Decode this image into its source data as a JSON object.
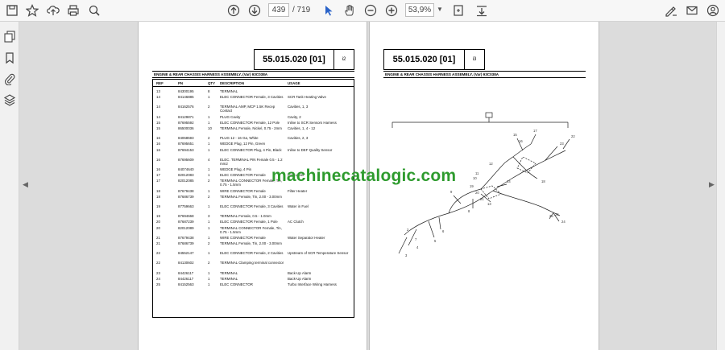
{
  "toolbar": {
    "current_page": "439",
    "page_total": "/ 719",
    "zoom_value": "53,9%",
    "icons": [
      "save-icon",
      "bookmark-star-icon",
      "upload-icon",
      "print-icon",
      "zoom-search-icon",
      "page-up-icon",
      "page-down-icon",
      "select-cursor-icon",
      "hand-tool-icon",
      "zoom-out-icon",
      "zoom-in-icon",
      "fit-page-icon",
      "scroll-mode-icon",
      "sign-icon",
      "email-icon",
      "account-icon"
    ]
  },
  "left_page": {
    "ref_number": "55.015.020 [01]",
    "ref_mark": "i2",
    "assembly_title": "ENGINE & REAR CHASSIS HARNESS ASSEMBLY, (Var) 93C038A",
    "headers": {
      "ref": "REF",
      "pn": "PN",
      "qty": "QTY",
      "desc": "DESCRIPTION",
      "usage": "USAGE"
    },
    "rows": [
      {
        "ref": "13",
        "pn": "84300195",
        "qty": "8",
        "desc": "TERMINAL",
        "usage": ""
      },
      {
        "ref": "14",
        "pn": "84146885",
        "qty": "1",
        "desc": "ELEC CONNECTOR Female, 3 Cavities",
        "usage": "SCR Tank Heating Valve"
      },
      {
        "ref": "14",
        "pn": "84162576",
        "qty": "2",
        "desc": "TERMINAL AMP, MCP 1.5K Recep Contact",
        "usage": "Cavities, 1, 3"
      },
      {
        "ref": "14",
        "pn": "84129871",
        "qty": "1",
        "desc": "PLUG Cavity",
        "usage": "Cavity, 2"
      },
      {
        "ref": "15",
        "pn": "87695592",
        "qty": "1",
        "desc": "ELEC CONNECTOR Female, 12 Pole",
        "usage": "Inline to SCR Sensors Harness"
      },
      {
        "ref": "15",
        "pn": "86500036",
        "qty": "10",
        "desc": "TERMINAL Female, Nickel, 0.75 - 2mm",
        "usage": "Cavities, 1, 4 - 12"
      },
      {
        "ref": "16",
        "pn": "84068593",
        "qty": "2",
        "desc": "PLUG 12 - 16 Ga, White",
        "usage": "Cavities, 2, 3"
      },
      {
        "ref": "16",
        "pn": "87695651",
        "qty": "1",
        "desc": "WEDGE Plug, 12 Pin, Green",
        "usage": ""
      },
      {
        "ref": "16",
        "pn": "87694153",
        "qty": "1",
        "desc": "ELEC CONNECTOR Plug, 4 Pin, Black",
        "usage": "Inline to DEF Quality Sensor"
      },
      {
        "ref": "16",
        "pn": "87695609",
        "qty": "4",
        "desc": "ELEC. TERMINAL PIN Female 0.5 - 1.2 mm2",
        "usage": ""
      },
      {
        "ref": "16",
        "pn": "84074640",
        "qty": "1",
        "desc": "WEDGE Plug, 4 Pin",
        "usage": ""
      },
      {
        "ref": "17",
        "pn": "82012083",
        "qty": "1",
        "desc": "ELEC CONNECTOR Female",
        "usage": "Fuel Level"
      },
      {
        "ref": "17",
        "pn": "82012085",
        "qty": "2",
        "desc": "TERMINAL CONNECTOR Female, Tin, 0.75 - 1.5mm",
        "usage": ""
      },
      {
        "ref": "18",
        "pn": "87679438",
        "qty": "1",
        "desc": "WIRE CONNECTOR Female",
        "usage": "Filter Heater"
      },
      {
        "ref": "18",
        "pn": "87686739",
        "qty": "2",
        "desc": "TERMINAL Female, Tin, 2.00 - 3.00mm",
        "usage": ""
      },
      {
        "ref": "19",
        "pn": "87759663",
        "qty": "1",
        "desc": "ELEC CONNECTOR Female, 3 Cavities",
        "usage": "Water in Fuel"
      },
      {
        "ref": "19",
        "pn": "87694668",
        "qty": "3",
        "desc": "TERMINAL Female, 0.5 - 1.0mm",
        "usage": ""
      },
      {
        "ref": "20",
        "pn": "87687239",
        "qty": "1",
        "desc": "ELEC CONNECTOR Female, 1 Pole",
        "usage": "AC Clutch"
      },
      {
        "ref": "20",
        "pn": "82012089",
        "qty": "1",
        "desc": "TERMINAL CONNECTOR Female, Tin, 0.75 - 1.5mm",
        "usage": ""
      },
      {
        "ref": "21",
        "pn": "87679438",
        "qty": "1",
        "desc": "WIRE CONNECTOR Female",
        "usage": "Water Separator Heater"
      },
      {
        "ref": "21",
        "pn": "87686739",
        "qty": "2",
        "desc": "TERMINAL Female, Tin, 2.00 - 3.00mm",
        "usage": ""
      },
      {
        "ref": "22",
        "pn": "84552147",
        "qty": "1",
        "desc": "ELEC CONNECTOR Female, 2 Cavities",
        "usage": "Upstream of SCR Temperature Sensor"
      },
      {
        "ref": "22",
        "pn": "84130602",
        "qty": "2",
        "desc": "TERMINAL Clamping terminal connector",
        "usage": ""
      },
      {
        "ref": "23",
        "pn": "84426117",
        "qty": "1",
        "desc": "TERMINAL",
        "usage": "Back-Up Alarm"
      },
      {
        "ref": "24",
        "pn": "84426117",
        "qty": "1",
        "desc": "TERMINAL",
        "usage": "Back-Up Alarm"
      },
      {
        "ref": "25",
        "pn": "84152563",
        "qty": "1",
        "desc": "ELEC CONNECTOR",
        "usage": "Turbo Interface Wiring Harness"
      }
    ]
  },
  "right_page": {
    "ref_number": "55.015.020 [01]",
    "ref_mark": "i3",
    "assembly_title": "ENGINE & REAR CHASSIS HARNESS ASSEMBLY, (Var) 93C038A",
    "callouts": [
      "2",
      "3",
      "4",
      "5",
      "6",
      "7",
      "8",
      "9",
      "10",
      "11",
      "12",
      "13",
      "14",
      "15",
      "16",
      "17",
      "18",
      "19",
      "20",
      "21",
      "22",
      "23",
      "24",
      "25",
      "26"
    ]
  },
  "watermark": "machinecatalogic.com"
}
